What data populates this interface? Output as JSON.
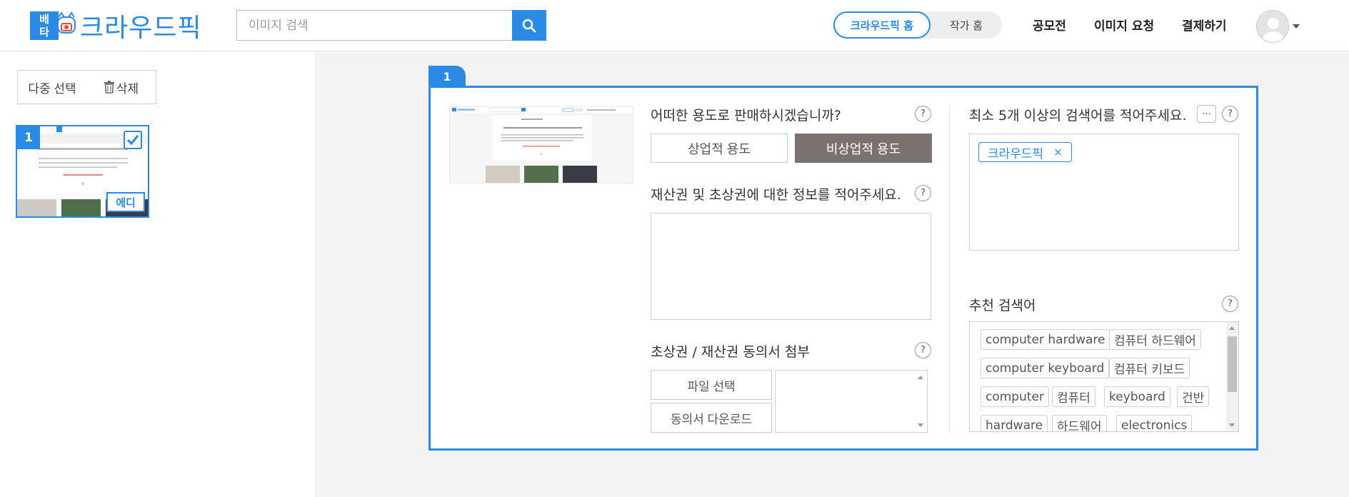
{
  "header": {
    "logo_badge_top": "베",
    "logo_badge_bottom": "타",
    "logo_text": "크라우드픽",
    "search_placeholder": "이미지 검색",
    "toggle_active": "크라우드픽 홈",
    "toggle_inactive": "작가 홈",
    "nav": [
      "공모전",
      "이미지 요청",
      "결제하기"
    ],
    "accent_color": "#2b8ae6"
  },
  "left_panel": {
    "multi_select_label": "다중 선택",
    "delete_label": "삭제",
    "thumb_number": "1",
    "thumb_edit_label": "에디"
  },
  "card": {
    "tab_number": "1",
    "usage_question": "어떠한 용도로 판매하시겠습니까?",
    "usage_options": [
      "상업적 용도",
      "비상업적 용도"
    ],
    "usage_selected": "비상업적 용도",
    "rights_question": "재산권 및 초상권에 대한 정보를 적어주세요.",
    "attach_title": "초상권 / 재산권 동의서 첨부",
    "file_select_label": "파일 선택",
    "consent_download_label": "동의서 다운로드",
    "keywords_question": "최소 5개 이상의 검색어를 적어주세요.",
    "more_label": "···",
    "keywords": [
      {
        "text": "크라우드픽",
        "remove": "×"
      }
    ],
    "recommended_title": "추천 검색어",
    "recommended": [
      "computer hardware",
      "컴퓨터 하드웨어",
      "computer keyboard",
      "컴퓨터 키보드",
      "computer",
      "컴퓨터",
      "keyboard",
      "건반",
      "hardware",
      "하드웨어",
      "electronics"
    ],
    "help_label": "?"
  }
}
